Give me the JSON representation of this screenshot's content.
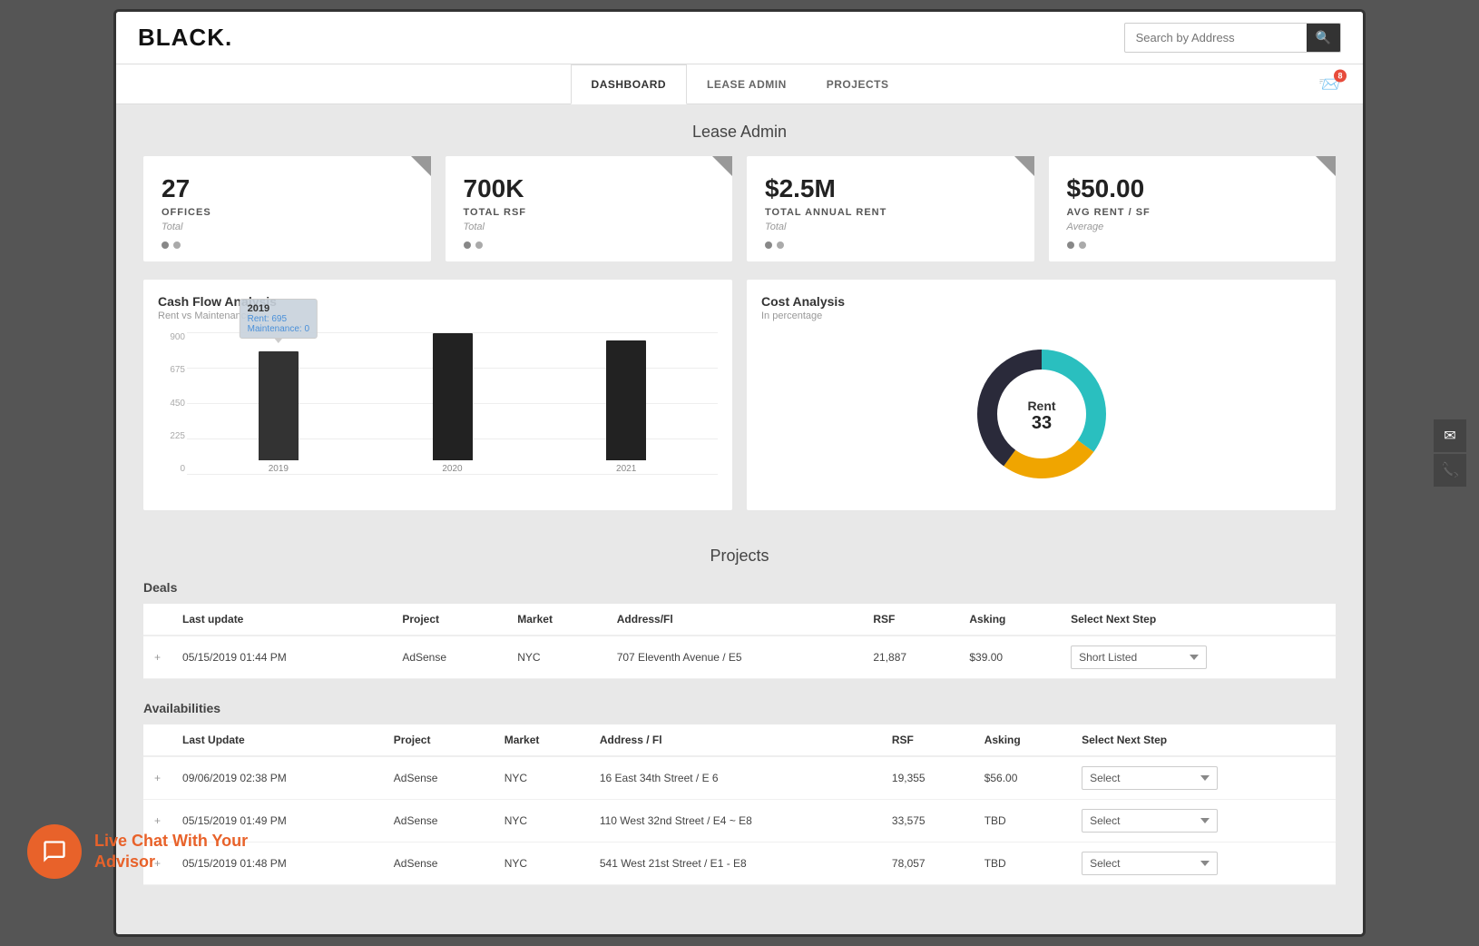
{
  "header": {
    "logo": "BLACK.",
    "search_placeholder": "Search by Address"
  },
  "nav": {
    "tabs": [
      {
        "id": "dashboard",
        "label": "DASHBOARD",
        "active": true
      },
      {
        "id": "lease-admin",
        "label": "LEASE ADMIN",
        "active": false
      },
      {
        "id": "projects",
        "label": "PROJECTS",
        "active": false
      }
    ],
    "notification_count": "8"
  },
  "lease_admin_section": {
    "title": "Lease Admin",
    "stats": [
      {
        "value": "27",
        "label": "OFFICES",
        "sublabel": "Total"
      },
      {
        "value": "700K",
        "label": "TOTAL RSF",
        "sublabel": "Total"
      },
      {
        "value": "$2.5M",
        "label": "TOTAL ANNUAL RENT",
        "sublabel": "Total"
      },
      {
        "value": "$50.00",
        "label": "AVG RENT / SF",
        "sublabel": "Average"
      }
    ],
    "cash_flow": {
      "title": "Cash Flow Analysis",
      "subtitle": "Rent vs Maintenance",
      "bars": [
        {
          "year": "2019",
          "rent": 695,
          "maintenance": 0,
          "height_pct": 77
        },
        {
          "year": "2020",
          "height_pct": 88
        },
        {
          "year": "2021",
          "height_pct": 83
        }
      ],
      "y_labels": [
        "900",
        "675",
        "450",
        "225",
        "0"
      ],
      "tooltip": {
        "year": "2019",
        "rent_label": "Rent:",
        "rent_val": "695",
        "maintenance_label": "Maintenance:",
        "maintenance_val": "0"
      }
    },
    "cost_analysis": {
      "title": "Cost Analysis",
      "subtitle": "In percentage",
      "center_label": "Rent",
      "center_value": "33",
      "donut": {
        "segments": [
          {
            "label": "Teal",
            "color": "#2abfbf",
            "pct": 35
          },
          {
            "label": "Gold",
            "color": "#f0a500",
            "pct": 25
          },
          {
            "label": "Dark",
            "color": "#2a2a3a",
            "pct": 40
          }
        ]
      }
    }
  },
  "projects_section": {
    "title": "Projects",
    "deals": {
      "label": "Deals",
      "columns": [
        "Last update",
        "Project",
        "Market",
        "Address/Fl",
        "RSF",
        "Asking",
        "Select Next Step"
      ],
      "rows": [
        {
          "last_update": "05/15/2019 01:44 PM",
          "project": "AdSense",
          "market": "NYC",
          "address": "707 Eleventh Avenue / E5",
          "rsf": "21,887",
          "asking": "$39.00",
          "select_value": "Short Listed"
        }
      ]
    },
    "availabilities": {
      "label": "Availabilities",
      "columns": [
        "Last Update",
        "Project",
        "Market",
        "Address / Fl",
        "RSF",
        "Asking",
        "Select Next Step"
      ],
      "rows": [
        {
          "last_update": "09/06/2019 02:38 PM",
          "project": "AdSense",
          "market": "NYC",
          "address": "16 East 34th Street / E 6",
          "rsf": "19,355",
          "asking": "$56.00",
          "select_value": "Select"
        },
        {
          "last_update": "05/15/2019 01:49 PM",
          "project": "AdSense",
          "market": "NYC",
          "address": "110 West 32nd Street / E4 ~ E8",
          "rsf": "33,575",
          "asking": "TBD",
          "select_value": "Select"
        },
        {
          "last_update": "05/15/2019 01:48 PM",
          "project": "AdSense",
          "market": "NYC",
          "address": "541 West 21st Street / E1 - E8",
          "rsf": "78,057",
          "asking": "TBD",
          "select_value": "Select"
        }
      ]
    }
  },
  "live_chat": {
    "icon": "💬",
    "line1": "Live Chat With Your",
    "line2": "Advisor"
  },
  "side_icons": {
    "email_icon": "✉",
    "phone_icon": "📞"
  }
}
